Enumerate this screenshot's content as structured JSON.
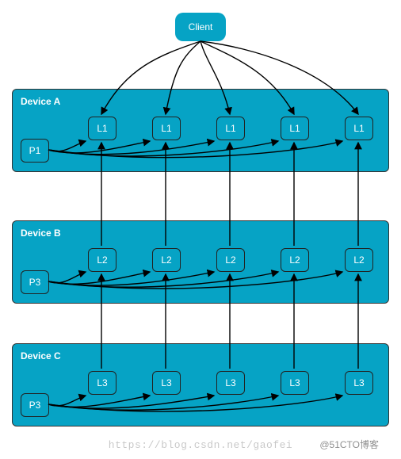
{
  "client": {
    "label": "Client"
  },
  "devices": {
    "a": {
      "title": "Device A",
      "p": "P1",
      "layers": [
        "L1",
        "L1",
        "L1",
        "L1",
        "L1"
      ]
    },
    "b": {
      "title": "Device B",
      "p": "P3",
      "layers": [
        "L2",
        "L2",
        "L2",
        "L2",
        "L2"
      ]
    },
    "c": {
      "title": "Device C",
      "p": "P3",
      "layers": [
        "L3",
        "L3",
        "L3",
        "L3",
        "L3"
      ]
    }
  },
  "watermark": {
    "url": "https://blog.csdn.net/gaofei",
    "tag": "@51CTO博客"
  }
}
